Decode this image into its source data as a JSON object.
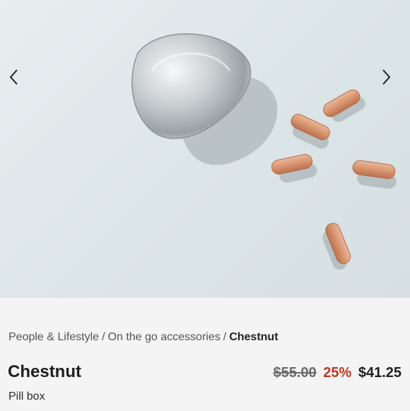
{
  "hero": {
    "image_name": "pill-box-with-capsules-photo",
    "prev_icon": "chevron-left-icon",
    "next_icon": "chevron-right-icon"
  },
  "breadcrumb": {
    "items": [
      "People & Lifestyle",
      "On the go accessories"
    ],
    "separator": "/",
    "current": "Chestnut"
  },
  "product": {
    "title": "Chestnut",
    "subtitle": "Pill box",
    "price_original": "$55.00",
    "discount": "25%",
    "price_sale": "$41.25"
  },
  "colors": {
    "discount": "#c2371f",
    "background": "#f4f4f4"
  }
}
